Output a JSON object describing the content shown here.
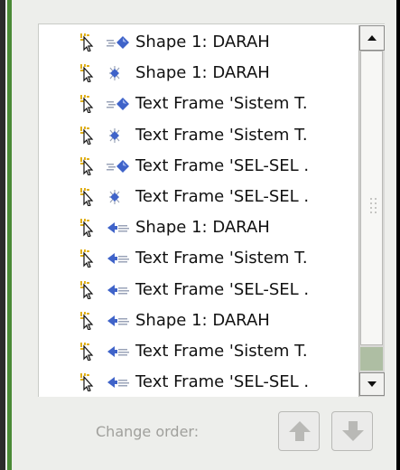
{
  "list": {
    "rows": [
      {
        "label": "Shape 1: DARAH",
        "action_icon": "arrow-right-diamond-icon"
      },
      {
        "label": "Shape 1: DARAH",
        "action_icon": "diamond-sparkle-icon"
      },
      {
        "label": "Text Frame 'Sistem T.",
        "action_icon": "arrow-right-diamond-icon"
      },
      {
        "label": "Text Frame 'Sistem T.",
        "action_icon": "diamond-sparkle-icon"
      },
      {
        "label": "Text Frame 'SEL-SEL .",
        "action_icon": "arrow-right-diamond-icon"
      },
      {
        "label": "Text Frame 'SEL-SEL .",
        "action_icon": "diamond-sparkle-icon"
      },
      {
        "label": "Shape 1: DARAH",
        "action_icon": "arrow-left-icon"
      },
      {
        "label": "Text Frame 'Sistem T.",
        "action_icon": "arrow-left-icon"
      },
      {
        "label": "Text Frame 'SEL-SEL .",
        "action_icon": "arrow-left-icon"
      },
      {
        "label": "Shape 1: DARAH",
        "action_icon": "arrow-left-icon"
      },
      {
        "label": "Text Frame 'Sistem T.",
        "action_icon": "arrow-left-icon"
      },
      {
        "label": "Text Frame 'SEL-SEL .",
        "action_icon": "arrow-left-icon"
      }
    ]
  },
  "order": {
    "label": "Change order:"
  },
  "colors": {
    "accent_green": "#4a8a36",
    "diamond_blue": "#3f63c9",
    "disabled_text": "#a0a09c"
  }
}
